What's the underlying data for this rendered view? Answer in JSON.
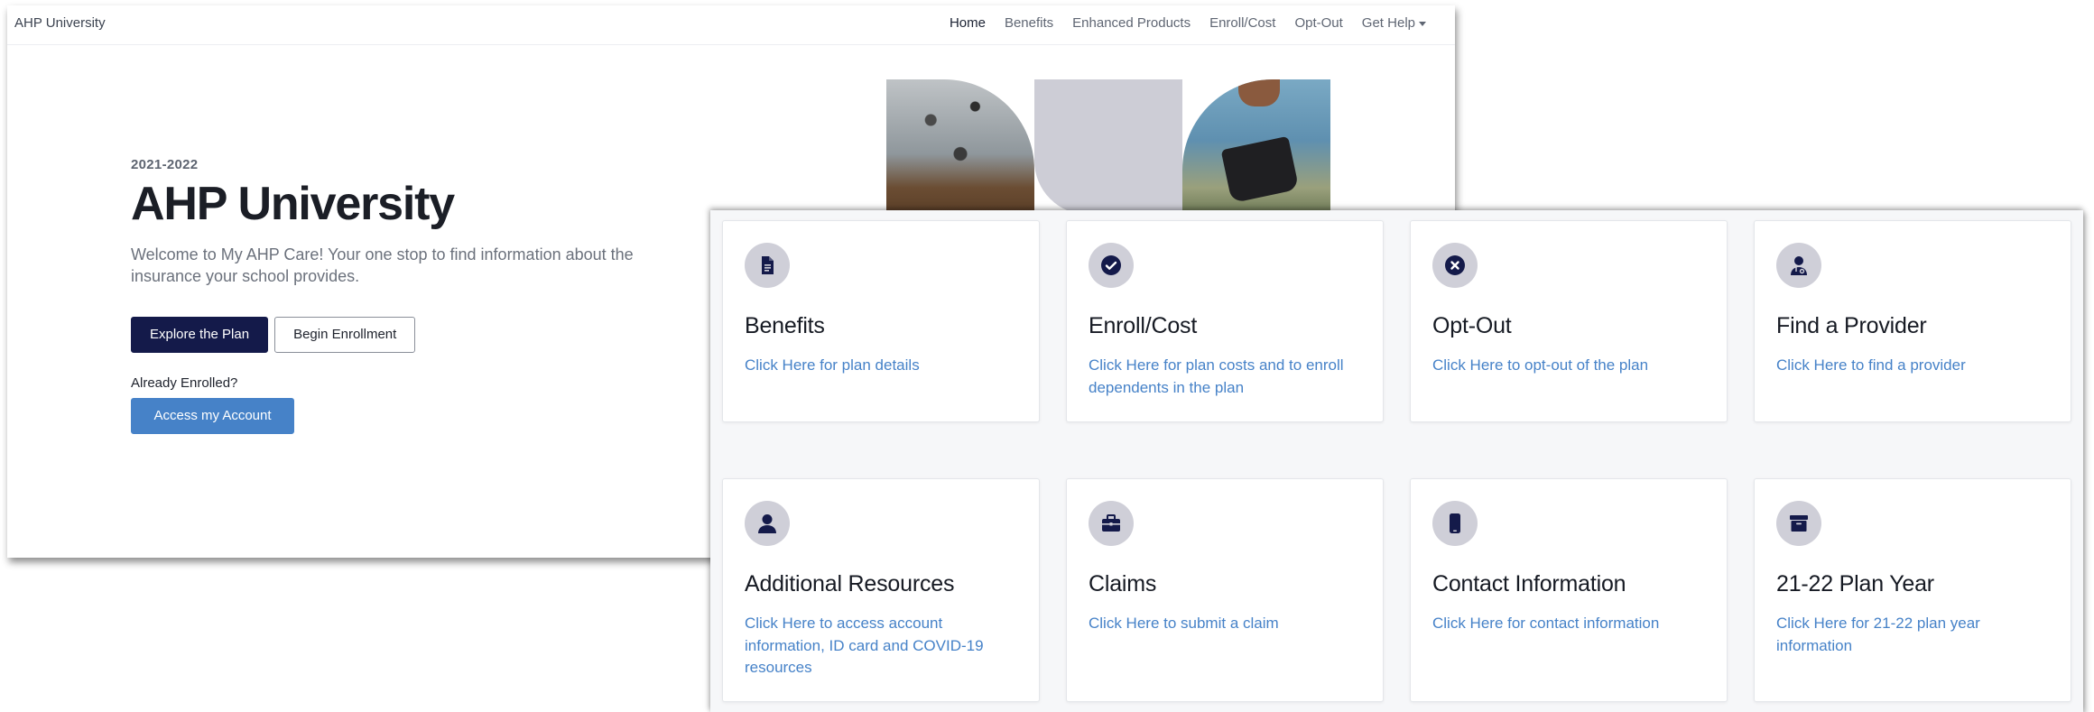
{
  "nav": {
    "brand": "AHP University",
    "links": [
      "Home",
      "Benefits",
      "Enhanced Products",
      "Enroll/Cost",
      "Opt-Out",
      "Get Help"
    ]
  },
  "hero": {
    "year": "2021-2022",
    "title": "AHP University",
    "text": "Welcome to My AHP Care! Your one stop to find information about the insurance your school provides.",
    "explore_button": "Explore the Plan",
    "enroll_button": "Begin Enrollment",
    "already_label": "Already Enrolled?",
    "account_button": "Access my Account"
  },
  "cards": [
    {
      "icon": "document-icon",
      "title": "Benefits",
      "link": "Click Here for plan details"
    },
    {
      "icon": "check-circle-icon",
      "title": "Enroll/Cost",
      "link": "Click Here for plan costs and to enroll dependents in the plan"
    },
    {
      "icon": "x-circle-icon",
      "title": "Opt-Out",
      "link": "Click Here to opt-out of the plan"
    },
    {
      "icon": "doctor-icon",
      "title": "Find a Provider",
      "link": "Click Here to find a provider"
    },
    {
      "icon": "user-icon",
      "title": "Additional Resources",
      "link": "Click Here to access account information, ID card and COVID-19 resources"
    },
    {
      "icon": "briefcase-icon",
      "title": "Claims",
      "link": "Click Here to submit a claim"
    },
    {
      "icon": "phone-icon",
      "title": "Contact Information",
      "link": "Click Here for contact information"
    },
    {
      "icon": "archive-icon",
      "title": "21-22 Plan Year",
      "link": "Click Here for 21-22 plan year information"
    }
  ],
  "colors": {
    "primary_dark": "#141a4a",
    "link_blue": "#4682c8",
    "icon_bg": "#cfcfd8"
  }
}
